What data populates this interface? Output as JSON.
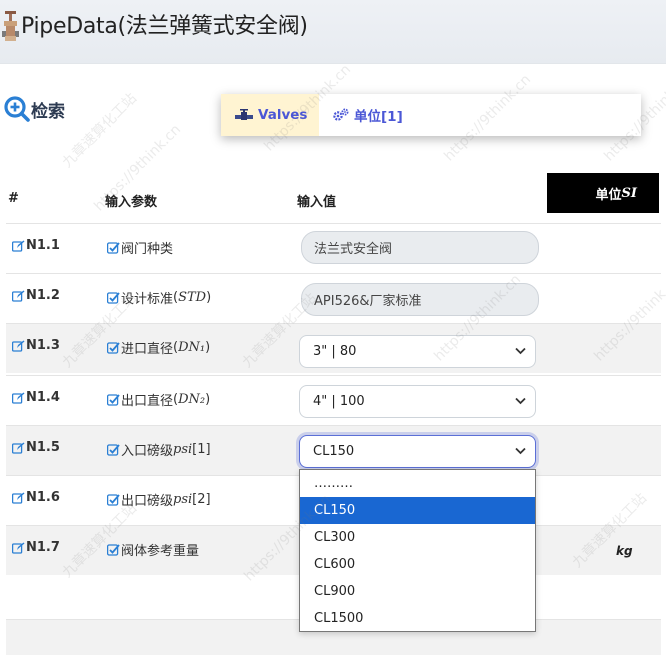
{
  "app": {
    "title": "PipeData(法兰弹簧式安全阀)"
  },
  "search": {
    "label": "检索"
  },
  "tabs": [
    {
      "label": "Valves"
    },
    {
      "label": "单位[1]"
    }
  ],
  "table": {
    "headers": {
      "index": "#",
      "param": "输入参数",
      "value": "输入值",
      "unit_prefix": "单位",
      "unit_system": "SI"
    },
    "rows": [
      {
        "id": "N1.1",
        "name": "阀门种类",
        "math": "",
        "suffix": "",
        "value": "法兰式安全阀",
        "kind": "field"
      },
      {
        "id": "N1.2",
        "name": "设计标准",
        "math": "STD",
        "suffix": "",
        "value": "API526&厂家标准",
        "kind": "field"
      },
      {
        "id": "N1.3",
        "name": "进口直径",
        "math": "DN₁",
        "suffix": "",
        "value": "3\" | 80",
        "kind": "select"
      },
      {
        "id": "N1.4",
        "name": "出口直径",
        "math": "DN₂",
        "suffix": "",
        "value": "4\" | 100",
        "kind": "select"
      },
      {
        "id": "N1.5",
        "name": "入口磅级",
        "math": "psi",
        "suffix": "[1]",
        "value": "CL150",
        "kind": "select"
      },
      {
        "id": "N1.6",
        "name": "出口磅级",
        "math": "psi",
        "suffix": "[2]",
        "value": "",
        "kind": "none"
      },
      {
        "id": "N1.7",
        "name": "阀体参考重量",
        "math": "",
        "suffix": "",
        "value": "",
        "kind": "none",
        "unit": "kg"
      }
    ]
  },
  "dropdown": {
    "options": [
      "………",
      "CL150",
      "CL300",
      "CL600",
      "CL900",
      "CL1500"
    ],
    "selected": "CL150"
  },
  "watermark": {
    "cn": "九章速算化工站",
    "url": "https://9think.cn"
  },
  "colors": {
    "accent": "#4b57d6",
    "tab_active_bg": "#fff4d2",
    "option_highlight": "#1967d2"
  }
}
